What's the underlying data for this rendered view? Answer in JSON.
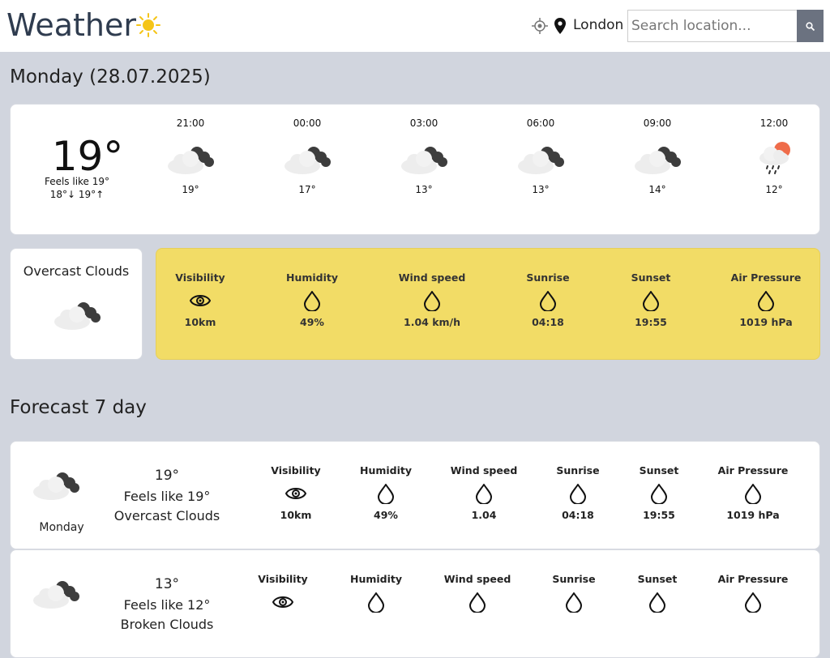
{
  "header": {
    "title": "Weather",
    "location": "London",
    "search_placeholder": "Search location..."
  },
  "today": {
    "title": "Monday (28.07.2025)",
    "temp": "19°",
    "feels_like": "Feels like 19°",
    "min_max": "18°↓  19°↑",
    "hours": [
      {
        "time": "21:00",
        "temp": "19°",
        "icon": "cloudy-icon"
      },
      {
        "time": "00:00",
        "temp": "17°",
        "icon": "cloudy-icon"
      },
      {
        "time": "03:00",
        "temp": "13°",
        "icon": "cloudy-icon"
      },
      {
        "time": "06:00",
        "temp": "13°",
        "icon": "cloudy-icon"
      },
      {
        "time": "09:00",
        "temp": "14°",
        "icon": "cloudy-icon"
      },
      {
        "time": "12:00",
        "temp": "12°",
        "icon": "rain-sun-icon"
      }
    ],
    "description": "Overcast Clouds",
    "stats": [
      {
        "label": "Visibility",
        "value": "10km",
        "icon": "eye-icon"
      },
      {
        "label": "Humidity",
        "value": "49%",
        "icon": "drop-icon"
      },
      {
        "label": "Wind speed",
        "value": "1.04 km/h",
        "icon": "drop-icon"
      },
      {
        "label": "Sunrise",
        "value": "04:18",
        "icon": "drop-icon"
      },
      {
        "label": "Sunset",
        "value": "19:55",
        "icon": "drop-icon"
      },
      {
        "label": "Air Pressure",
        "value": "1019 hPa",
        "icon": "drop-icon"
      }
    ]
  },
  "forecast": {
    "title": "Forecast 7 day",
    "rows": [
      {
        "day": "Monday",
        "temp": "19°",
        "feels_like": "Feels like 19°",
        "description": "Overcast Clouds",
        "stats": [
          {
            "label": "Visibility",
            "value": "10km"
          },
          {
            "label": "Humidity",
            "value": "49%"
          },
          {
            "label": "Wind speed",
            "value": "1.04"
          },
          {
            "label": "Sunrise",
            "value": "04:18"
          },
          {
            "label": "Sunset",
            "value": "19:55"
          },
          {
            "label": "Air Pressure",
            "value": "1019 hPa"
          }
        ]
      },
      {
        "day": "",
        "temp": "13°",
        "feels_like": "Feels like 12°",
        "description": "Broken Clouds",
        "stats": [
          {
            "label": "Visibility",
            "value": ""
          },
          {
            "label": "Humidity",
            "value": ""
          },
          {
            "label": "Wind speed",
            "value": ""
          },
          {
            "label": "Sunrise",
            "value": ""
          },
          {
            "label": "Sunset",
            "value": ""
          },
          {
            "label": "Air Pressure",
            "value": ""
          }
        ]
      }
    ]
  },
  "colors": {
    "stats_card": "#f2dc66",
    "sun": "#f5c518",
    "search_button": "#6b7280"
  }
}
